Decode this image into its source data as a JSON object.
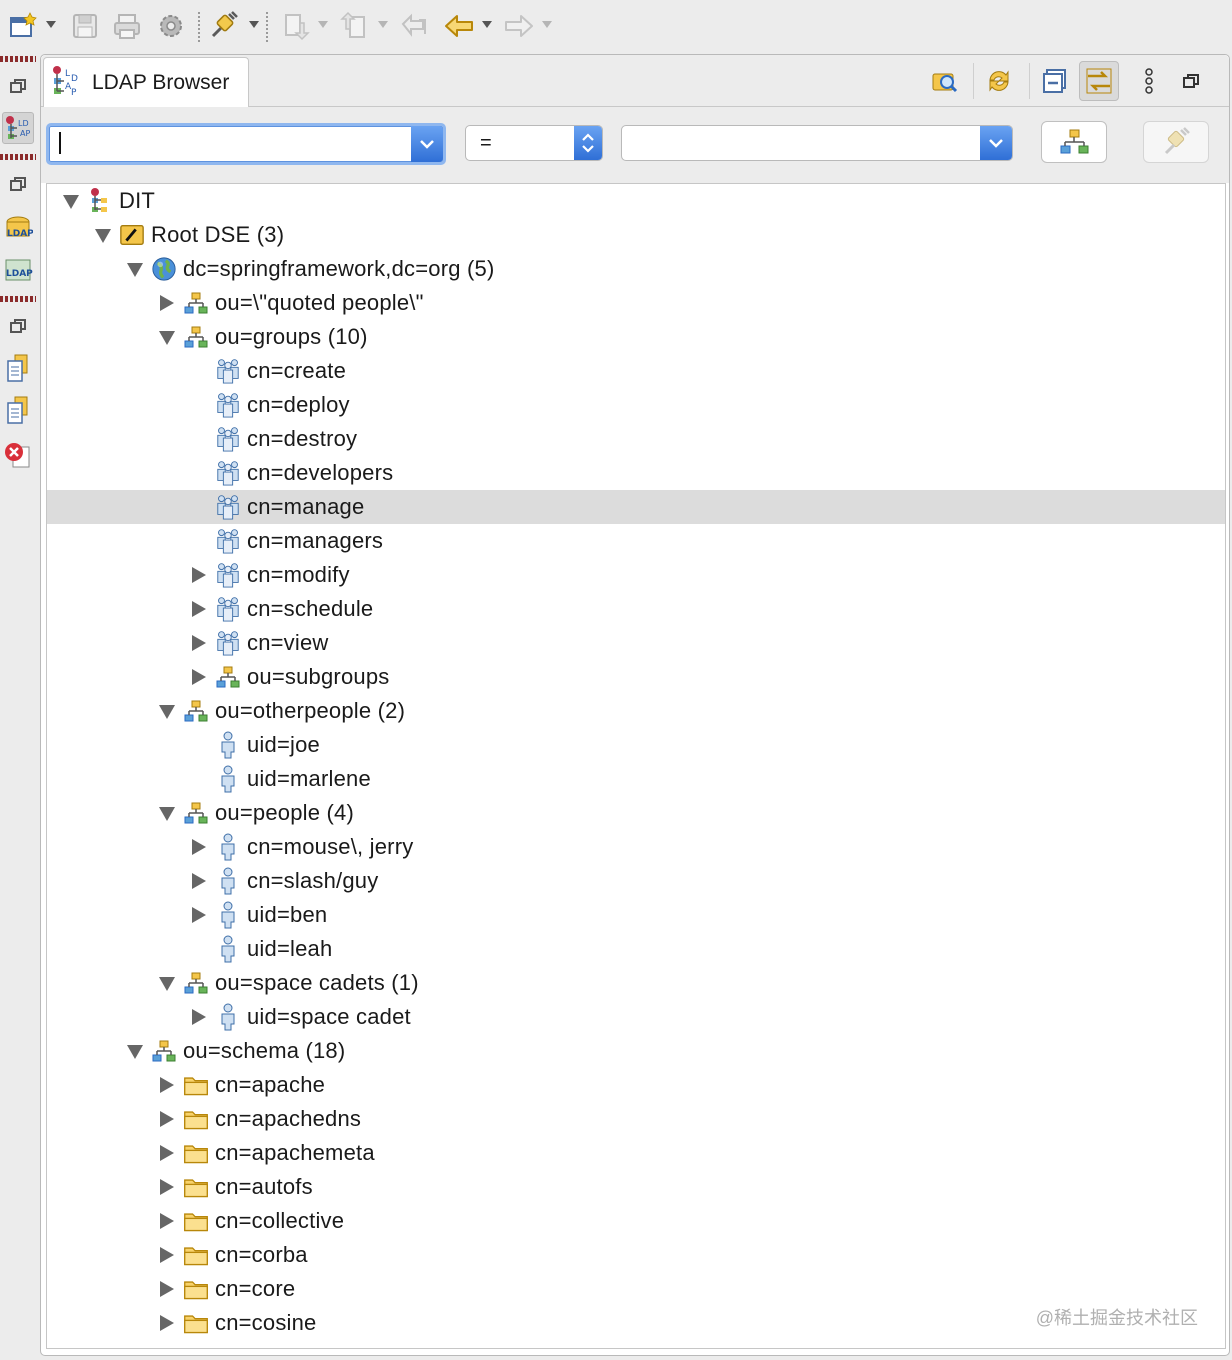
{
  "view": {
    "tab_title": "LDAP Browser"
  },
  "filter": {
    "attribute_value": "",
    "operator": "=",
    "value": ""
  },
  "tree": [
    {
      "label": "DIT",
      "level": 0,
      "state": "open",
      "icon": "dit-icon"
    },
    {
      "label": "Root DSE (3)",
      "level": 1,
      "state": "open",
      "icon": "root-dse-icon"
    },
    {
      "label": "dc=springframework,dc=org (5)",
      "level": 2,
      "state": "open",
      "icon": "globe-icon"
    },
    {
      "label": "ou=\\\"quoted people\\\"",
      "level": 3,
      "state": "closed",
      "icon": "org-unit-icon"
    },
    {
      "label": "ou=groups (10)",
      "level": 3,
      "state": "open",
      "icon": "org-unit-icon"
    },
    {
      "label": "cn=create",
      "level": 4,
      "state": "leaf",
      "icon": "group-icon"
    },
    {
      "label": "cn=deploy",
      "level": 4,
      "state": "leaf",
      "icon": "group-icon"
    },
    {
      "label": "cn=destroy",
      "level": 4,
      "state": "leaf",
      "icon": "group-icon"
    },
    {
      "label": "cn=developers",
      "level": 4,
      "state": "leaf",
      "icon": "group-icon"
    },
    {
      "label": "cn=manage",
      "level": 4,
      "state": "leaf",
      "icon": "group-icon",
      "selected": true
    },
    {
      "label": "cn=managers",
      "level": 4,
      "state": "leaf",
      "icon": "group-icon"
    },
    {
      "label": "cn=modify",
      "level": 4,
      "state": "closed",
      "icon": "group-icon"
    },
    {
      "label": "cn=schedule",
      "level": 4,
      "state": "closed",
      "icon": "group-icon"
    },
    {
      "label": "cn=view",
      "level": 4,
      "state": "closed",
      "icon": "group-icon"
    },
    {
      "label": "ou=subgroups",
      "level": 4,
      "state": "closed",
      "icon": "org-unit-icon"
    },
    {
      "label": "ou=otherpeople (2)",
      "level": 3,
      "state": "open",
      "icon": "org-unit-icon"
    },
    {
      "label": "uid=joe",
      "level": 4,
      "state": "leaf",
      "icon": "person-icon"
    },
    {
      "label": "uid=marlene",
      "level": 4,
      "state": "leaf",
      "icon": "person-icon"
    },
    {
      "label": "ou=people (4)",
      "level": 3,
      "state": "open",
      "icon": "org-unit-icon"
    },
    {
      "label": "cn=mouse\\, jerry",
      "level": 4,
      "state": "closed",
      "icon": "person-icon"
    },
    {
      "label": "cn=slash/guy",
      "level": 4,
      "state": "closed",
      "icon": "person-icon"
    },
    {
      "label": "uid=ben",
      "level": 4,
      "state": "closed",
      "icon": "person-icon"
    },
    {
      "label": "uid=leah",
      "level": 4,
      "state": "leaf",
      "icon": "person-icon"
    },
    {
      "label": "ou=space cadets (1)",
      "level": 3,
      "state": "open",
      "icon": "org-unit-icon"
    },
    {
      "label": "uid=space cadet",
      "level": 4,
      "state": "closed",
      "icon": "person-icon"
    },
    {
      "label": "ou=schema (18)",
      "level": 2,
      "state": "open",
      "icon": "org-unit-icon"
    },
    {
      "label": "cn=apache",
      "level": 3,
      "state": "closed",
      "icon": "folder-icon"
    },
    {
      "label": "cn=apachedns",
      "level": 3,
      "state": "closed",
      "icon": "folder-icon"
    },
    {
      "label": "cn=apachemeta",
      "level": 3,
      "state": "closed",
      "icon": "folder-icon"
    },
    {
      "label": "cn=autofs",
      "level": 3,
      "state": "closed",
      "icon": "folder-icon"
    },
    {
      "label": "cn=collective",
      "level": 3,
      "state": "closed",
      "icon": "folder-icon"
    },
    {
      "label": "cn=corba",
      "level": 3,
      "state": "closed",
      "icon": "folder-icon"
    },
    {
      "label": "cn=core",
      "level": 3,
      "state": "closed",
      "icon": "folder-icon"
    },
    {
      "label": "cn=cosine",
      "level": 3,
      "state": "closed",
      "icon": "folder-icon"
    }
  ],
  "watermark": "@稀土掘金技术社区"
}
